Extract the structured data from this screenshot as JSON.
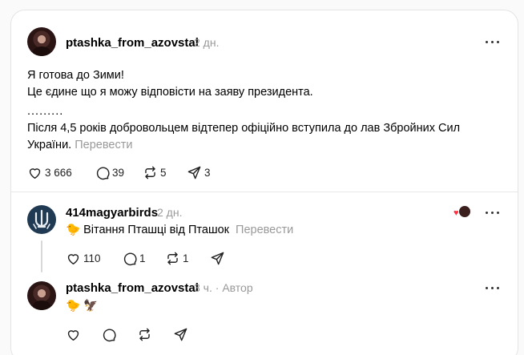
{
  "post": {
    "username": "ptashka_from_azovstal",
    "time": "2 дн.",
    "lines": [
      "Я готова до Зими!",
      "Це єдине що я можу відповісти на заяву президента.",
      ".........",
      "Після 4,5 років добровольцем відтепер офіційно вступила до лав Збройних Сил",
      "України."
    ],
    "translate": "Перевести",
    "likes": "3 666",
    "comments": "39",
    "reposts": "5",
    "shares": "3"
  },
  "reply1": {
    "username": "414magyarbirds",
    "time": "2 дн.",
    "text": "Вітання Пташці від Пташок",
    "emoji": "🐤",
    "translate": "Перевести",
    "likes": "110",
    "comments": "1",
    "reposts": "1"
  },
  "reply2": {
    "username": "ptashka_from_azovstal",
    "time": "3 ч.",
    "author_label": "Автор",
    "emojis": "🐤 🦅"
  }
}
